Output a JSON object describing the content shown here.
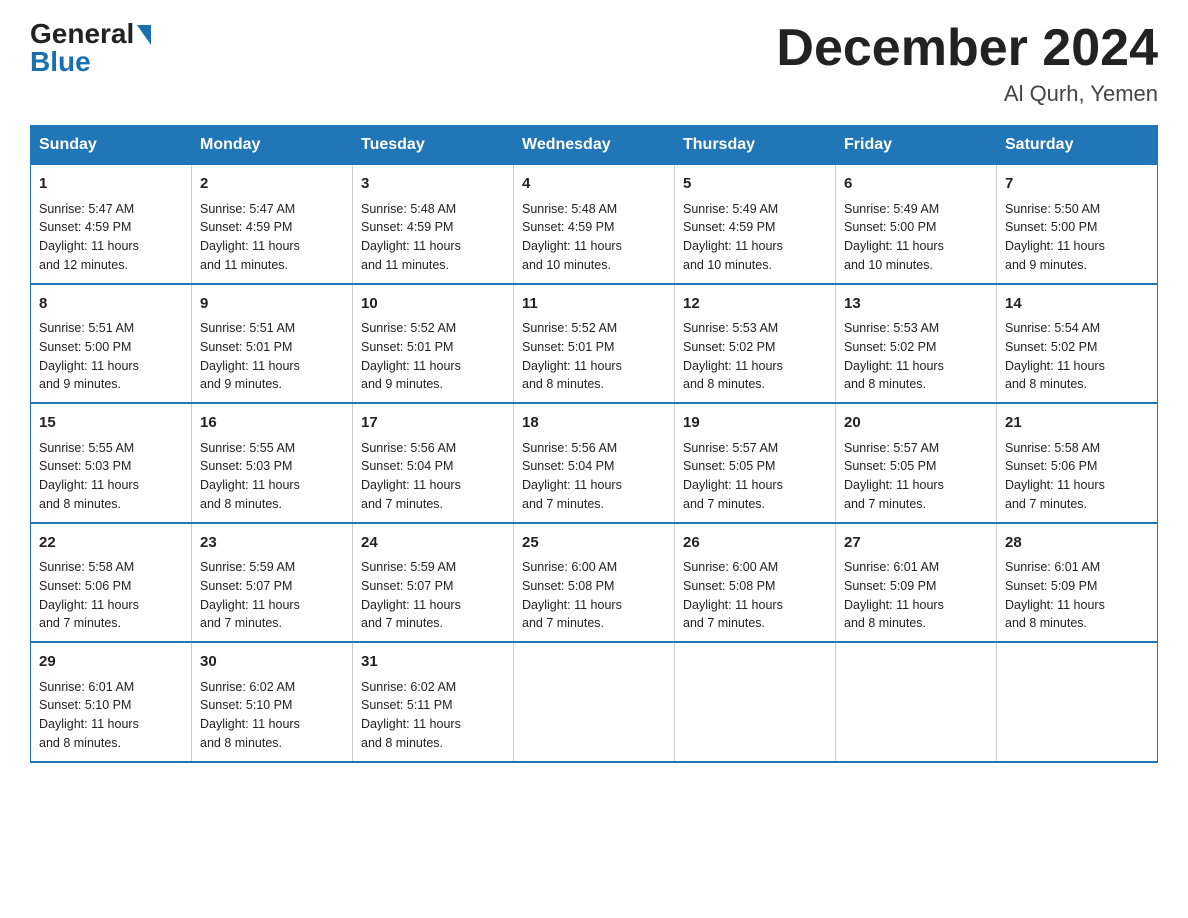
{
  "logo": {
    "general": "General",
    "blue": "Blue"
  },
  "title": "December 2024",
  "subtitle": "Al Qurh, Yemen",
  "days_header": [
    "Sunday",
    "Monday",
    "Tuesday",
    "Wednesday",
    "Thursday",
    "Friday",
    "Saturday"
  ],
  "weeks": [
    [
      {
        "num": "1",
        "sunrise": "5:47 AM",
        "sunset": "4:59 PM",
        "daylight": "11 hours and 12 minutes."
      },
      {
        "num": "2",
        "sunrise": "5:47 AM",
        "sunset": "4:59 PM",
        "daylight": "11 hours and 11 minutes."
      },
      {
        "num": "3",
        "sunrise": "5:48 AM",
        "sunset": "4:59 PM",
        "daylight": "11 hours and 11 minutes."
      },
      {
        "num": "4",
        "sunrise": "5:48 AM",
        "sunset": "4:59 PM",
        "daylight": "11 hours and 10 minutes."
      },
      {
        "num": "5",
        "sunrise": "5:49 AM",
        "sunset": "4:59 PM",
        "daylight": "11 hours and 10 minutes."
      },
      {
        "num": "6",
        "sunrise": "5:49 AM",
        "sunset": "5:00 PM",
        "daylight": "11 hours and 10 minutes."
      },
      {
        "num": "7",
        "sunrise": "5:50 AM",
        "sunset": "5:00 PM",
        "daylight": "11 hours and 9 minutes."
      }
    ],
    [
      {
        "num": "8",
        "sunrise": "5:51 AM",
        "sunset": "5:00 PM",
        "daylight": "11 hours and 9 minutes."
      },
      {
        "num": "9",
        "sunrise": "5:51 AM",
        "sunset": "5:01 PM",
        "daylight": "11 hours and 9 minutes."
      },
      {
        "num": "10",
        "sunrise": "5:52 AM",
        "sunset": "5:01 PM",
        "daylight": "11 hours and 9 minutes."
      },
      {
        "num": "11",
        "sunrise": "5:52 AM",
        "sunset": "5:01 PM",
        "daylight": "11 hours and 8 minutes."
      },
      {
        "num": "12",
        "sunrise": "5:53 AM",
        "sunset": "5:02 PM",
        "daylight": "11 hours and 8 minutes."
      },
      {
        "num": "13",
        "sunrise": "5:53 AM",
        "sunset": "5:02 PM",
        "daylight": "11 hours and 8 minutes."
      },
      {
        "num": "14",
        "sunrise": "5:54 AM",
        "sunset": "5:02 PM",
        "daylight": "11 hours and 8 minutes."
      }
    ],
    [
      {
        "num": "15",
        "sunrise": "5:55 AM",
        "sunset": "5:03 PM",
        "daylight": "11 hours and 8 minutes."
      },
      {
        "num": "16",
        "sunrise": "5:55 AM",
        "sunset": "5:03 PM",
        "daylight": "11 hours and 8 minutes."
      },
      {
        "num": "17",
        "sunrise": "5:56 AM",
        "sunset": "5:04 PM",
        "daylight": "11 hours and 7 minutes."
      },
      {
        "num": "18",
        "sunrise": "5:56 AM",
        "sunset": "5:04 PM",
        "daylight": "11 hours and 7 minutes."
      },
      {
        "num": "19",
        "sunrise": "5:57 AM",
        "sunset": "5:05 PM",
        "daylight": "11 hours and 7 minutes."
      },
      {
        "num": "20",
        "sunrise": "5:57 AM",
        "sunset": "5:05 PM",
        "daylight": "11 hours and 7 minutes."
      },
      {
        "num": "21",
        "sunrise": "5:58 AM",
        "sunset": "5:06 PM",
        "daylight": "11 hours and 7 minutes."
      }
    ],
    [
      {
        "num": "22",
        "sunrise": "5:58 AM",
        "sunset": "5:06 PM",
        "daylight": "11 hours and 7 minutes."
      },
      {
        "num": "23",
        "sunrise": "5:59 AM",
        "sunset": "5:07 PM",
        "daylight": "11 hours and 7 minutes."
      },
      {
        "num": "24",
        "sunrise": "5:59 AM",
        "sunset": "5:07 PM",
        "daylight": "11 hours and 7 minutes."
      },
      {
        "num": "25",
        "sunrise": "6:00 AM",
        "sunset": "5:08 PM",
        "daylight": "11 hours and 7 minutes."
      },
      {
        "num": "26",
        "sunrise": "6:00 AM",
        "sunset": "5:08 PM",
        "daylight": "11 hours and 7 minutes."
      },
      {
        "num": "27",
        "sunrise": "6:01 AM",
        "sunset": "5:09 PM",
        "daylight": "11 hours and 8 minutes."
      },
      {
        "num": "28",
        "sunrise": "6:01 AM",
        "sunset": "5:09 PM",
        "daylight": "11 hours and 8 minutes."
      }
    ],
    [
      {
        "num": "29",
        "sunrise": "6:01 AM",
        "sunset": "5:10 PM",
        "daylight": "11 hours and 8 minutes."
      },
      {
        "num": "30",
        "sunrise": "6:02 AM",
        "sunset": "5:10 PM",
        "daylight": "11 hours and 8 minutes."
      },
      {
        "num": "31",
        "sunrise": "6:02 AM",
        "sunset": "5:11 PM",
        "daylight": "11 hours and 8 minutes."
      },
      null,
      null,
      null,
      null
    ]
  ],
  "sunrise_label": "Sunrise:",
  "sunset_label": "Sunset:",
  "daylight_label": "Daylight:"
}
